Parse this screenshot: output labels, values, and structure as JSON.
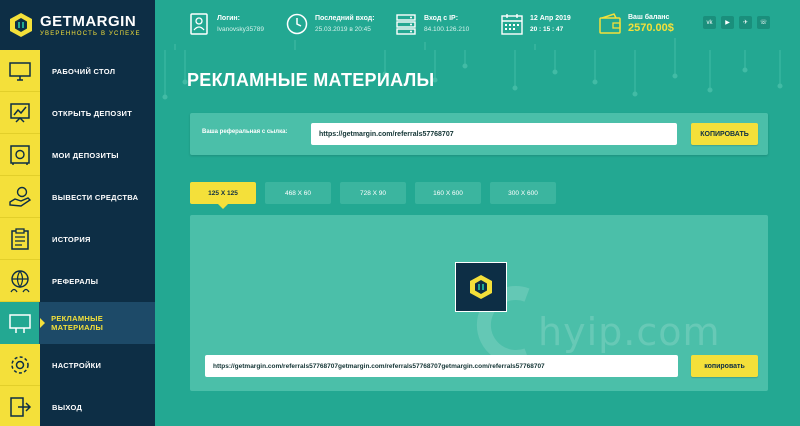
{
  "brand": {
    "name": "GETMARGIN",
    "tagline": "УВЕРЕННОСТЬ В УСПЕХЕ"
  },
  "colors": {
    "sidebar": "#0d2e45",
    "accent_yellow": "#f4e03a",
    "background_teal": "#23a892",
    "panel_teal": "#4bbfa9"
  },
  "topbar": {
    "login": {
      "label": "Логин:",
      "value": "Ivanovsky35789",
      "icon": "user-card-icon"
    },
    "last_login": {
      "label": "Последний вход:",
      "value": "25.03.2019 в 20:45",
      "icon": "clock-icon"
    },
    "ip": {
      "label": "Вход с IP:",
      "value": "84.100.126.210",
      "icon": "server-icon"
    },
    "date": {
      "label": "12 Апр 2019",
      "value": "20 : 15 : 47",
      "icon": "calendar-icon"
    },
    "balance": {
      "label": "Ваш баланс",
      "value": "2570.00$",
      "icon": "wallet-icon"
    },
    "social": [
      "vk",
      "▶",
      "✈",
      "☏"
    ]
  },
  "sidebar": {
    "items": [
      {
        "label": "РАБОЧИЙ СТОЛ",
        "icon": "monitor-icon"
      },
      {
        "label": "ОТКРЫТЬ ДЕПОЗИТ",
        "icon": "chart-board-icon"
      },
      {
        "label": "МОИ ДЕПОЗИТЫ",
        "icon": "safe-icon"
      },
      {
        "label": "ВЫВЕСТИ СРЕДСТВА",
        "icon": "hand-coin-icon"
      },
      {
        "label": "ИСТОРИЯ",
        "icon": "clipboard-icon"
      },
      {
        "label": "РЕФЕРАЛЫ",
        "icon": "globe-users-icon"
      },
      {
        "label": "РЕКЛАМНЫЕ МАТЕРИАЛЫ",
        "icon": "billboard-icon",
        "active": true
      },
      {
        "label": "НАСТРОЙКИ",
        "icon": "gear-icon"
      },
      {
        "label": "ВЫХОД",
        "icon": "exit-icon"
      }
    ]
  },
  "page": {
    "title": "РЕКЛАМНЫЕ МАТЕРИАЛЫ",
    "ref_label": "Ваша реферальная с сылка:",
    "ref_link": "https://getmargin.com/referrals57768707",
    "copy_label": "КОПИРОВАТЬ",
    "tabs": [
      "125 X 125",
      "468 X 60",
      "728 X 90",
      "160 X 600",
      "300 X 600"
    ],
    "active_tab": "125 X 125",
    "banner_code": "https://getmargin.com/referrals57768707getmargin.com/referrals57768707getmargin.com/referrals57768707",
    "copy_label_2": "копировать"
  },
  "watermark": "hyip.com"
}
